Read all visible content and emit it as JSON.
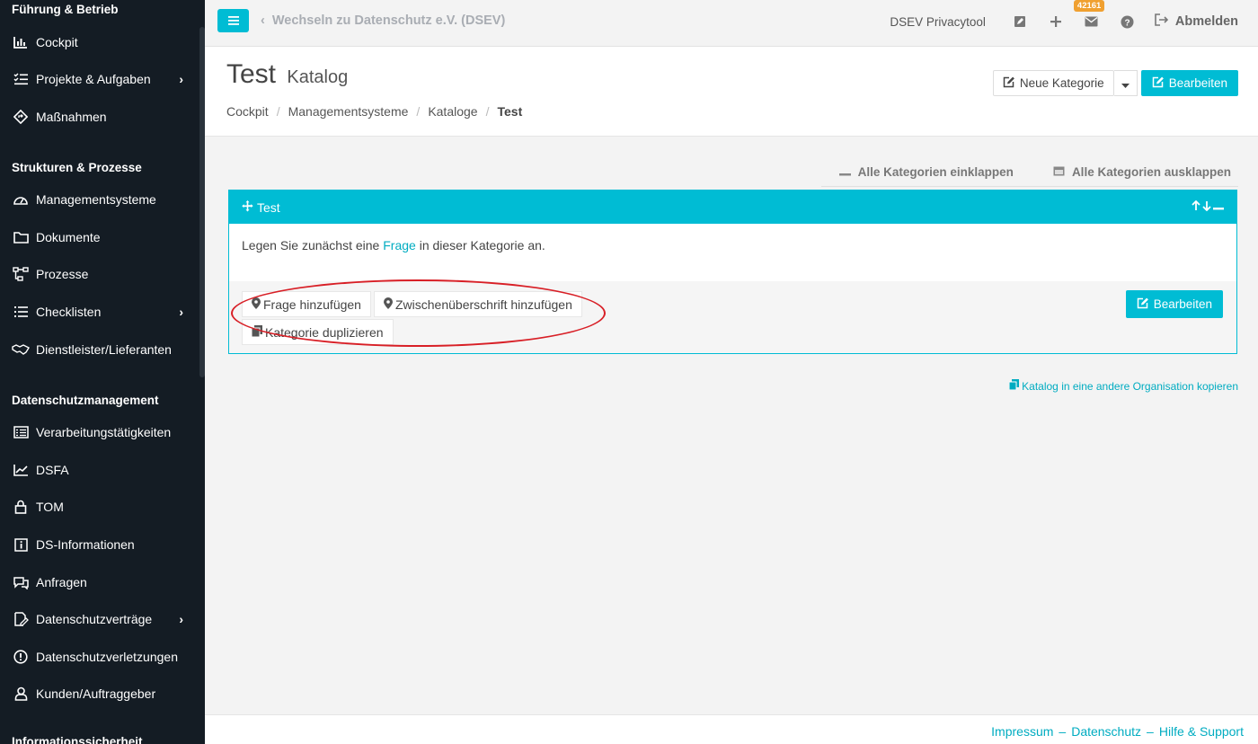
{
  "sidebar": {
    "sections": [
      {
        "title": "Führung & Betrieb"
      },
      {
        "title": "Strukturen & Prozesse"
      },
      {
        "title": "Datenschutzmanagement"
      },
      {
        "title": "Informationssicherheit"
      }
    ],
    "items": [
      {
        "label": "Cockpit",
        "icon": "bar-chart-icon"
      },
      {
        "label": "Projekte & Aufgaben",
        "icon": "task-list-icon"
      },
      {
        "label": "Maßnahmen",
        "icon": "diamond-arrow-icon"
      },
      {
        "label": "Managementsysteme",
        "icon": "gauge-icon"
      },
      {
        "label": "Dokumente",
        "icon": "folder-icon"
      },
      {
        "label": "Prozesse",
        "icon": "process-flow-icon"
      },
      {
        "label": "Checklisten",
        "icon": "list-icon"
      },
      {
        "label": "Dienstleister/Lieferanten",
        "icon": "handshake-icon"
      },
      {
        "label": "Verarbeitungstätigkeiten",
        "icon": "table-list-icon"
      },
      {
        "label": "DSFA",
        "icon": "line-chart-icon"
      },
      {
        "label": "TOM",
        "icon": "lock-icon"
      },
      {
        "label": "DS-Informationen",
        "icon": "info-icon"
      },
      {
        "label": "Anfragen",
        "icon": "chat-icon"
      },
      {
        "label": "Datenschutzverträge",
        "icon": "contract-icon"
      },
      {
        "label": "Datenschutzverletzungen",
        "icon": "alert-icon"
      },
      {
        "label": "Kunden/Auftraggeber",
        "icon": "user-icon"
      }
    ]
  },
  "topbar": {
    "back_label": "Wechseln zu Datenschutz e.V. (DSEV)",
    "tool_name": "DSEV Privacytool",
    "badge_count": "42161",
    "logout_label": "Abmelden"
  },
  "header": {
    "title": "Test",
    "subtitle": "Katalog",
    "breadcrumb": [
      "Cockpit",
      "Managementsysteme",
      "Kataloge",
      "Test"
    ],
    "new_category_label": "Neue Kategorie",
    "edit_label": "Bearbeiten"
  },
  "collapse": {
    "collapse_all": "Alle Kategorien einklappen",
    "expand_all": "Alle Kategorien ausklappen"
  },
  "category": {
    "title": "Test",
    "body_prefix": "Legen Sie zunächst eine",
    "body_link": "Frage",
    "body_suffix": "in dieser Kategorie an.",
    "add_question": "Frage hinzufügen",
    "add_subheading": "Zwischenüberschrift hinzufügen",
    "duplicate": "Kategorie duplizieren",
    "edit_label": "Bearbeiten"
  },
  "copy_link": "Katalog in eine andere Organisation kopieren",
  "footer": {
    "impressum": "Impressum",
    "datenschutz": "Datenschutz",
    "hilfe": "Hilfe & Support",
    "dash": "–"
  },
  "colors": {
    "accent": "#00bcd4",
    "sidebar_bg": "#141c24",
    "highlight": "#d81f26",
    "badge": "#f0a030"
  }
}
